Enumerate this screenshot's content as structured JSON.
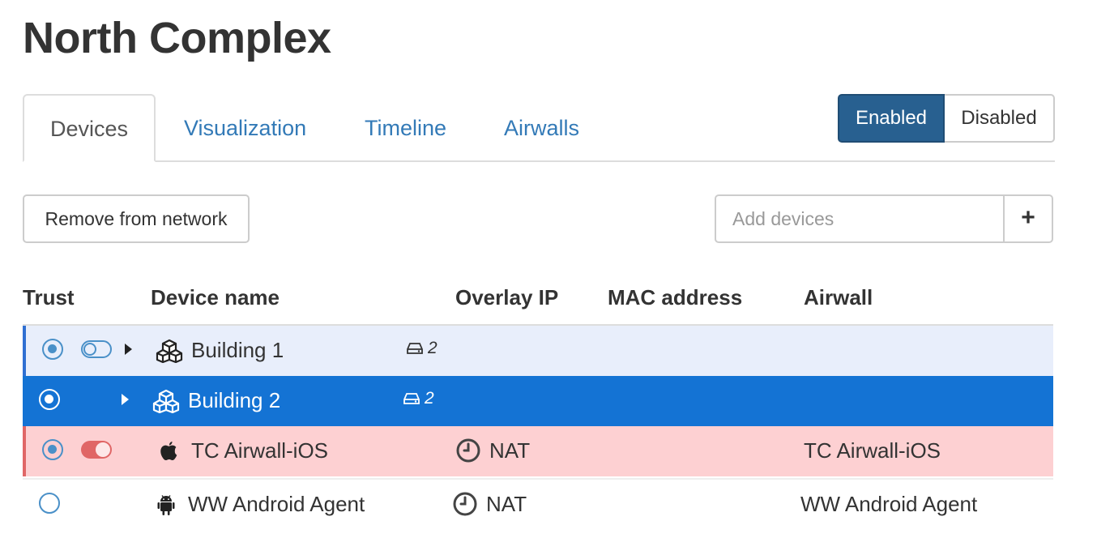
{
  "page": {
    "title": "North Complex"
  },
  "tabs": [
    {
      "label": "Devices",
      "active": true
    },
    {
      "label": "Visualization",
      "active": false
    },
    {
      "label": "Timeline",
      "active": false
    },
    {
      "label": "Airwalls",
      "active": false
    }
  ],
  "status_toggle": {
    "enabled_label": "Enabled",
    "disabled_label": "Disabled",
    "selected": "Enabled"
  },
  "toolbar": {
    "remove_label": "Remove from network"
  },
  "add_devices": {
    "placeholder": "Add devices",
    "value": "",
    "add_symbol": "+"
  },
  "table": {
    "columns": [
      "Trust",
      "Device name",
      "Overlay IP",
      "MAC address",
      "Airwall"
    ],
    "rows": [
      {
        "name": "Building 1",
        "icon": "cubes-icon",
        "device_count": "2",
        "overlay_ip": "",
        "mac_address": "",
        "airwall": "",
        "trusted": true,
        "switch": "off",
        "expandable": true,
        "state": "highlighted"
      },
      {
        "name": "Building 2",
        "icon": "cubes-icon",
        "device_count": "2",
        "overlay_ip": "",
        "mac_address": "",
        "airwall": "",
        "trusted": true,
        "switch": "none",
        "expandable": true,
        "state": "selected"
      },
      {
        "name": "TC Airwall-iOS",
        "icon": "apple-icon",
        "overlay_ip": "NAT",
        "mac_address": "",
        "airwall": "TC Airwall-iOS",
        "trusted": true,
        "switch": "on",
        "expandable": false,
        "state": "alert"
      },
      {
        "name": "WW Android Agent",
        "icon": "android-icon",
        "overlay_ip": "NAT",
        "mac_address": "",
        "airwall": "WW Android Agent",
        "trusted": false,
        "switch": "none",
        "expandable": false,
        "state": "normal"
      }
    ]
  },
  "colors": {
    "primary": "#286090",
    "link": "#337ab7",
    "selected_row": "#1473d4",
    "highlight_row": "#e8eefb",
    "alert_row": "#fdd0d2",
    "alert_accent": "#e06666"
  }
}
